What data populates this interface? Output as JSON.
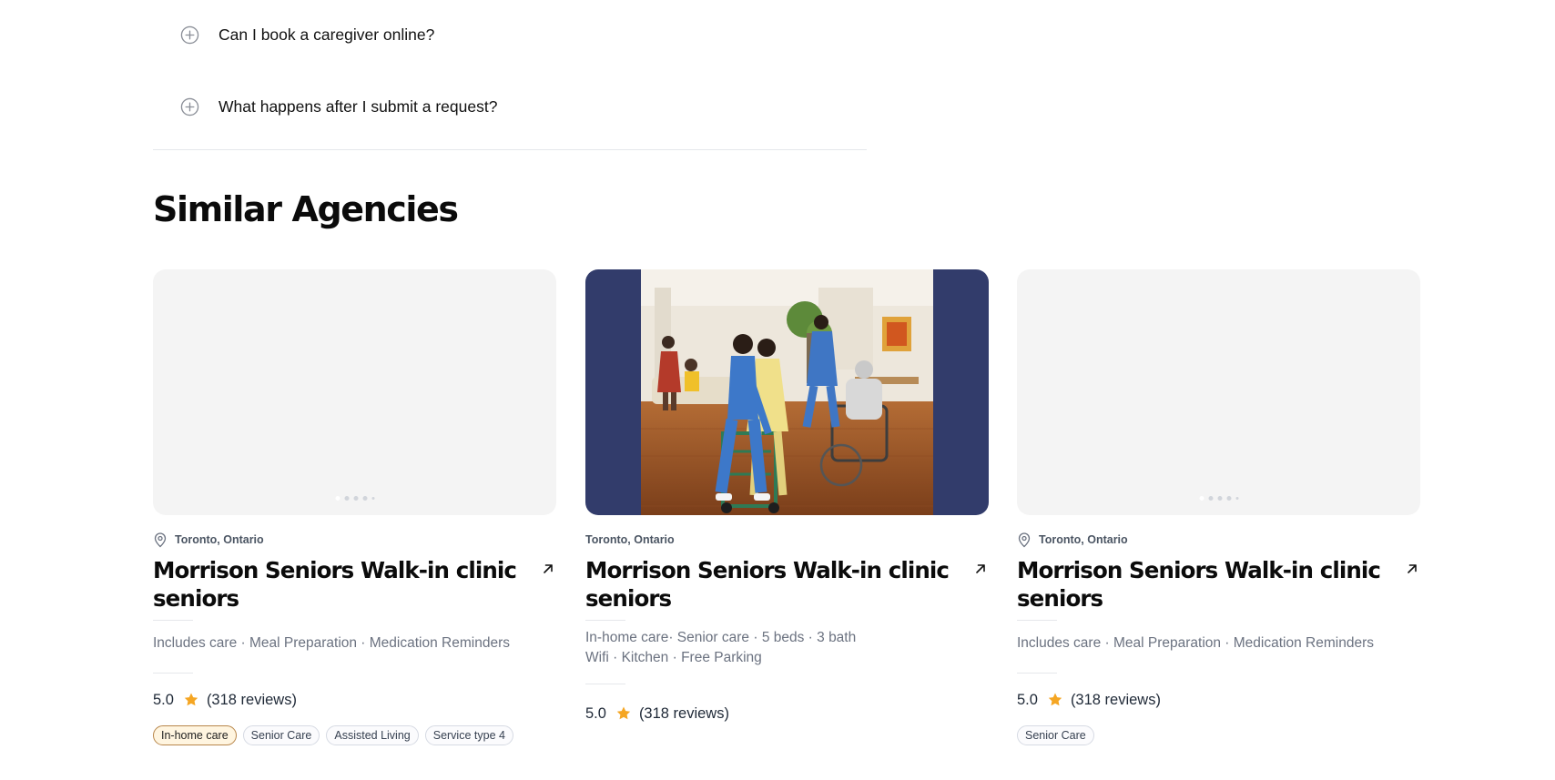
{
  "faq": {
    "items": [
      {
        "question": "Can I book a caregiver online?"
      },
      {
        "question": "What happens after I submit a request?"
      }
    ]
  },
  "section": {
    "title": "Similar Agencies"
  },
  "cards": [
    {
      "location": "Toronto, Ontario",
      "title": "Morrison Seniors Walk-in clinic seniors",
      "description": "Includes care · Meal Preparation · Medication Reminders",
      "rating": "5.0",
      "reviews": "(318 reviews)",
      "tags": [
        "In-home care",
        "Senior Care",
        "Assisted Living",
        "Service type 4"
      ]
    },
    {
      "location": "Toronto, Ontario",
      "title": "Morrison Seniors Walk-in clinic seniors",
      "description_line1": "In-home care· Senior care · 5 beds · 3 bath",
      "description_line2": "Wifi · Kitchen · Free Parking",
      "rating": "5.0",
      "reviews": "(318 reviews)"
    },
    {
      "location": "Toronto, Ontario",
      "title": "Morrison Seniors Walk-in clinic seniors",
      "description": "Includes care · Meal Preparation · Medication Reminders",
      "rating": "5.0",
      "reviews": "(318 reviews)",
      "tags": [
        "Senior Care"
      ]
    }
  ],
  "colors": {
    "star": "#f5a623",
    "photo_bg": "#323c6b",
    "tag_accent_border": "#b8864a"
  },
  "icons": {
    "faq": "plus-circle-icon",
    "location": "map-pin-icon",
    "link": "arrow-up-right-icon",
    "rating": "star-icon"
  }
}
